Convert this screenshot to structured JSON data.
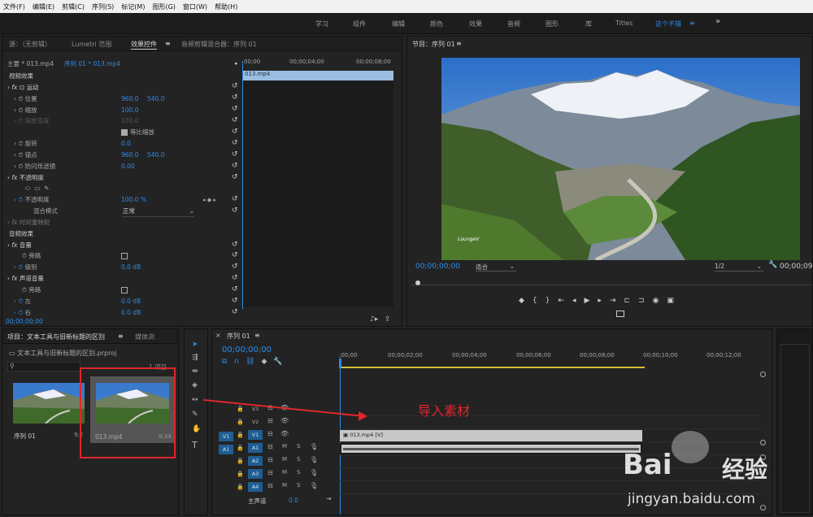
{
  "menu": [
    "文件(F)",
    "编辑(E)",
    "剪辑(C)",
    "序列(S)",
    "标记(M)",
    "图形(G)",
    "窗口(W)",
    "帮助(H)"
  ],
  "workspaces": [
    "学习",
    "组件",
    "编辑",
    "颜色",
    "效果",
    "音频",
    "图形",
    "库",
    "Titles",
    "这个不错",
    "≡",
    "»"
  ],
  "source_panel": {
    "tabs": [
      "源：（无剪辑）",
      "Lumetri 范围",
      "效果控件",
      "≡",
      "音频剪辑混合器：序列 01"
    ],
    "master": "主要 * 013.mp4",
    "seq": "序列 01 * 013.mp4",
    "ruler": [
      "00;00",
      "00;00;04;00",
      "00;00;08;00"
    ],
    "clip": "013.mp4",
    "rows": [
      "视频效果",
      "fx",
      "运动",
      "位置",
      "960.0",
      "540.0",
      "缩放",
      "100.0",
      "缩放宽度",
      "100.0",
      "等比缩放",
      "旋转",
      "0.0",
      "锚点",
      "960.0",
      "540.0",
      "防闪烁滤镜",
      "0.00",
      "fx",
      "不透明度",
      "不透明度",
      "100.0 %",
      "混合模式",
      "正常",
      "fx",
      "时间重映射",
      "音频效果",
      "fx",
      "音量",
      "旁路",
      "级别",
      "0.0 dB",
      "fx",
      "声道音量",
      "旁路",
      "左",
      "0.0 dB",
      "右",
      "0.0 dB"
    ],
    "timecode": "00;00;00;00"
  },
  "program": {
    "title": "节目：序列 01",
    "menu_icon": "≡",
    "timecode": "00;00;00;00",
    "fit": "适合",
    "res": "1/2",
    "end_tc": "00;00;09;",
    "watermark": "LoungeV"
  },
  "project": {
    "tabs": [
      "项目：文本工具与旧新标题的区别",
      "≡",
      "媒体浏"
    ],
    "file": "文本工具与旧新标题的区别.prproj",
    "count": "1 项目",
    "items": [
      {
        "name": "序列 01",
        "dur": "9;2"
      },
      {
        "name": "013.mp4",
        "dur": "9;34"
      }
    ]
  },
  "timeline": {
    "tab": "序列 01",
    "menu_icon": "≡",
    "timecode": "00;00;00;00",
    "ruler": [
      ";00;00",
      "00;00;02;00",
      "00;00;04;00",
      "00;00;06;00",
      "00;00;08;00",
      "00;00;10;00",
      "00;00;12;00"
    ],
    "tracks": [
      "V3",
      "V2",
      "V1",
      "A1",
      "A2",
      "A3",
      "A4"
    ],
    "src_v": "V1",
    "src_a": "A1",
    "master": "主声道",
    "master_val": "0.0",
    "clip_v": "013.mp4 [V]",
    "m": "M",
    "s": "S"
  },
  "annotation": "导入素材",
  "watermark": {
    "baidu": "Bai",
    "du": "经验",
    "url": "jingyan.baidu.com"
  }
}
